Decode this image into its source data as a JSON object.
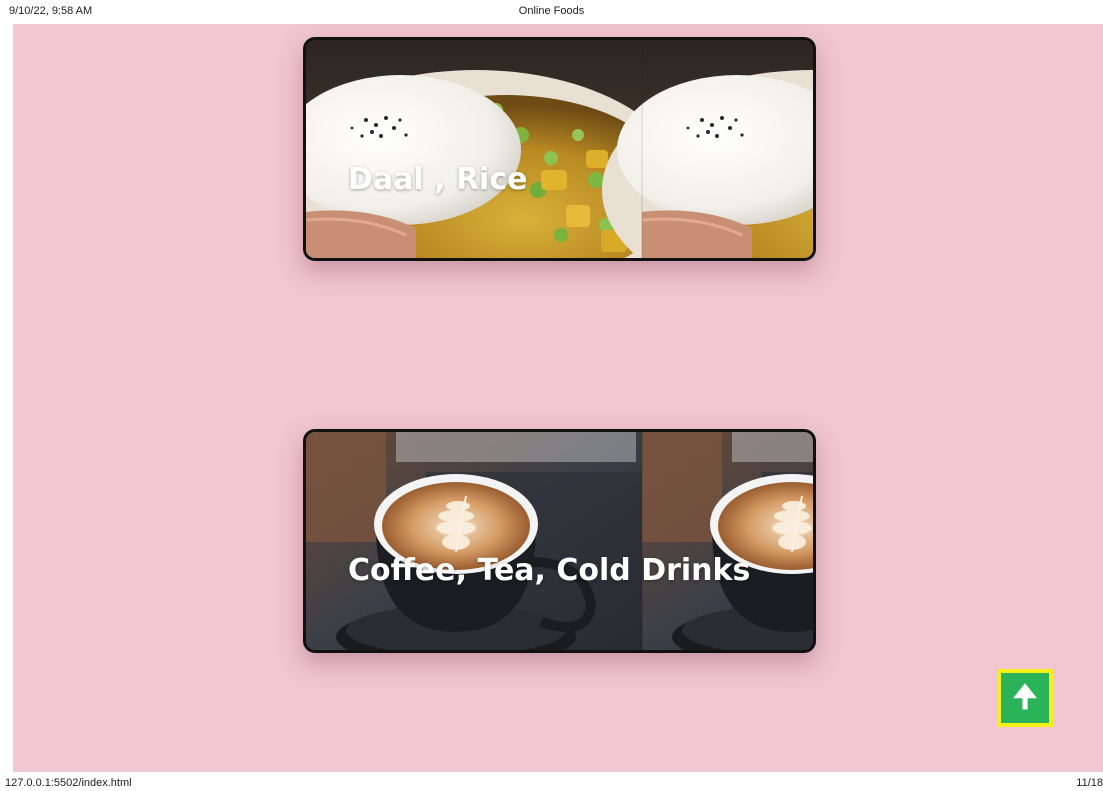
{
  "print_header": {
    "datetime": "9/10/22, 9:58 AM",
    "page_title": "Online Foods"
  },
  "cards": [
    {
      "label": "Daal , Rice",
      "image": "daal-rice-photo"
    },
    {
      "label": "Coffee, Tea, Cold Drinks",
      "image": "coffee-cup-photo"
    }
  ],
  "scroll_top": {
    "icon": "arrow-up-icon",
    "glyph": "🠉"
  },
  "print_footer": {
    "url": "127.0.0.1:5502/index.html",
    "page_counter": "11/18"
  },
  "colors": {
    "page_background": "#f1c6d0",
    "scroll_button_bg": "#2bb35a",
    "scroll_button_border": "#f4f01a",
    "card_border": "#111111",
    "card_text": "#ffffff"
  }
}
